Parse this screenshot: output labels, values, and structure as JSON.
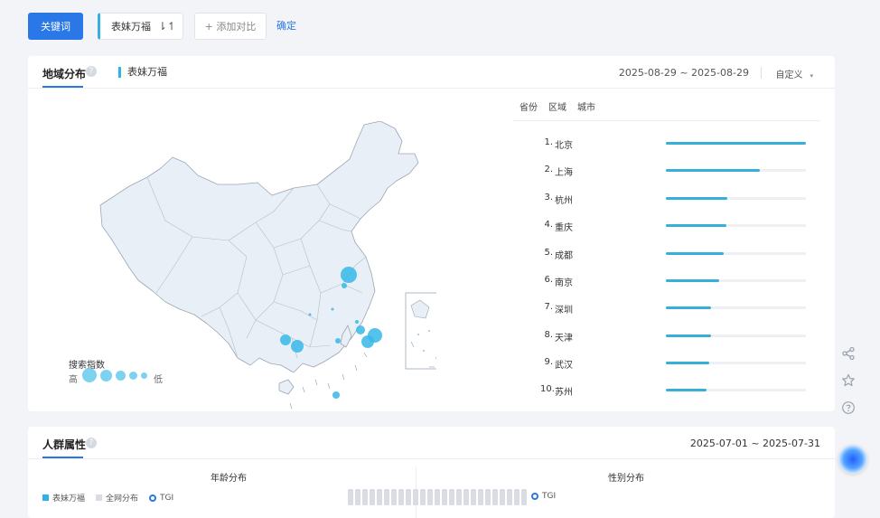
{
  "toolbar": {
    "keyword_button": "关键词",
    "keyword_chip": "表妹万福",
    "swap_glyph": "⇂↿",
    "add_compare": "+ 添加对比",
    "confirm": "确定"
  },
  "region": {
    "title": "地域分布",
    "help": "?",
    "legend_label": "表妹万福",
    "date_range": "2025-08-29 ~ 2025-08-29",
    "custom_label": "自定义",
    "custom_caret": "▾",
    "map_legend_title": "搜索指数",
    "map_legend_high": "高",
    "map_legend_low": "低",
    "tabs": [
      "省份",
      "区域",
      "城市"
    ],
    "ranking": [
      {
        "rank": "1.",
        "name": "北京",
        "value": 100
      },
      {
        "rank": "2.",
        "name": "上海",
        "value": 67
      },
      {
        "rank": "3.",
        "name": "杭州",
        "value": 44
      },
      {
        "rank": "4.",
        "name": "重庆",
        "value": 43
      },
      {
        "rank": "5.",
        "name": "成都",
        "value": 41
      },
      {
        "rank": "6.",
        "name": "南京",
        "value": 38
      },
      {
        "rank": "7.",
        "name": "深圳",
        "value": 32
      },
      {
        "rank": "8.",
        "name": "天津",
        "value": 32
      },
      {
        "rank": "9.",
        "name": "武汉",
        "value": 31
      },
      {
        "rank": "10.",
        "name": "苏州",
        "value": 29
      }
    ]
  },
  "crowd": {
    "title": "人群属性",
    "help": "?",
    "date_range": "2025-07-01 ~ 2025-07-31",
    "age_title": "年龄分布",
    "gender_title": "性别分布",
    "age_legend": [
      "表妹万福",
      "全网分布",
      "TGI"
    ],
    "gender_legend": [
      "TGI"
    ]
  },
  "colors": {
    "primary": "#2a78e8",
    "series": "#36b0e4",
    "map_fill": "#e8eff6",
    "bubble": "#36b7e8"
  },
  "icons": {
    "share": "share-icon",
    "star": "star-icon",
    "help": "help-icon",
    "assistant": "assistant-icon"
  }
}
